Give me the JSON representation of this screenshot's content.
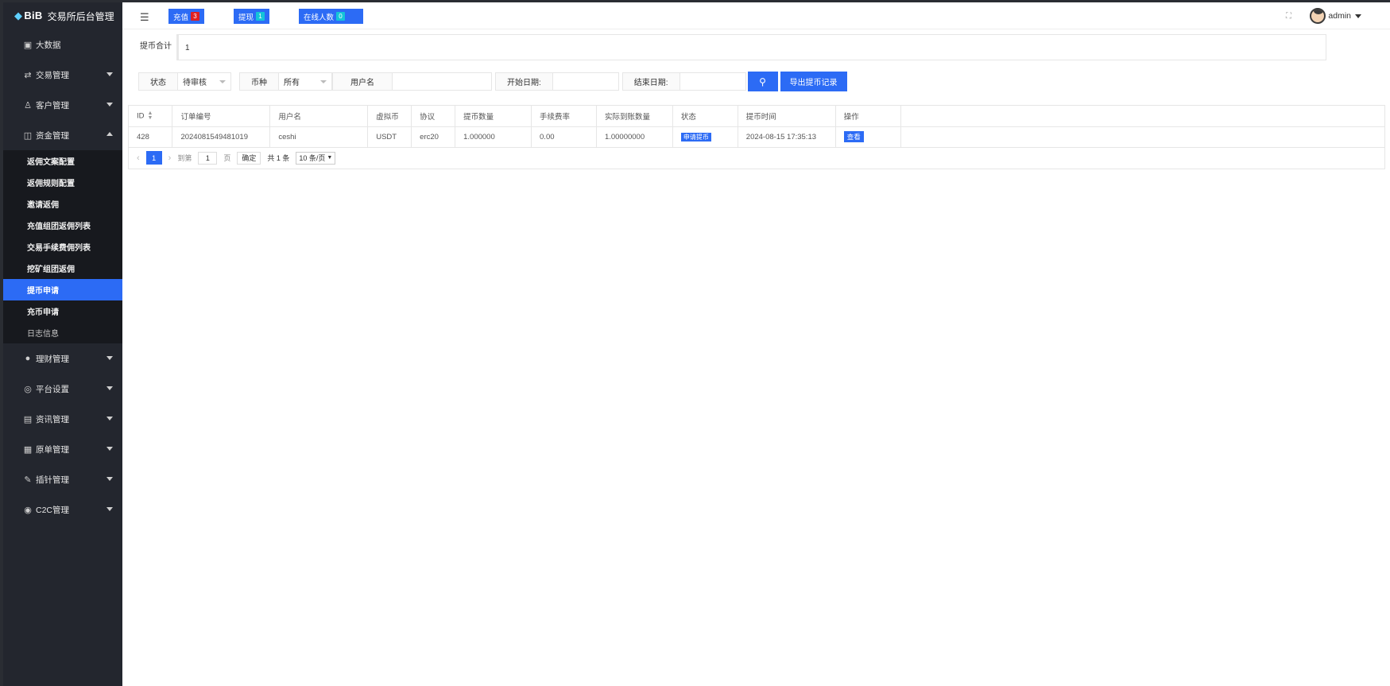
{
  "app": {
    "logo_text": "BiB",
    "title": "交易所后台管理"
  },
  "topbar": {
    "recharge_label": "充值",
    "recharge_count": "3",
    "withdraw_label": "提现",
    "withdraw_count": "1",
    "online_label": "在线人数",
    "online_count": "0",
    "user_name": "admin"
  },
  "sidebar": {
    "items": [
      {
        "label": "大数据",
        "icon": "dashboard-icon"
      },
      {
        "label": "交易管理",
        "icon": "exchange-icon"
      },
      {
        "label": "客户管理",
        "icon": "users-icon"
      },
      {
        "label": "资金管理",
        "icon": "wallet-icon"
      }
    ],
    "sub_items": [
      {
        "label": "返佣文案配置"
      },
      {
        "label": "返佣规则配置"
      },
      {
        "label": "邀请返佣"
      },
      {
        "label": "充值组团返佣列表"
      },
      {
        "label": "交易手续费佣列表"
      },
      {
        "label": "挖矿组团返佣"
      },
      {
        "label": "提币申请"
      },
      {
        "label": "充币申请"
      },
      {
        "label": "日志信息"
      }
    ],
    "items_after": [
      {
        "label": "理财管理",
        "icon": "piggy-bank-icon"
      },
      {
        "label": "平台设置",
        "icon": "settings-icon"
      },
      {
        "label": "资讯管理",
        "icon": "news-icon"
      },
      {
        "label": "原单管理",
        "icon": "document-icon"
      },
      {
        "label": "插针管理",
        "icon": "needle-icon"
      },
      {
        "label": "C2C管理",
        "icon": "c2c-icon"
      }
    ]
  },
  "summary": {
    "label": "提币合计",
    "value": "1"
  },
  "filters": {
    "status_label": "状态",
    "status_value": "待审核",
    "coin_label": "币种",
    "coin_value": "所有",
    "username_label": "用户名",
    "start_date_label": "开始日期:",
    "end_date_label": "结束日期:",
    "export_label": "导出提币记录"
  },
  "table": {
    "headers": [
      "ID",
      "订单编号",
      "用户名",
      "虚拟币",
      "协议",
      "提币数量",
      "手续费率",
      "实际到账数量",
      "状态",
      "提币时间",
      "操作"
    ],
    "rows": [
      {
        "id": "428",
        "order_no": "2024081549481019",
        "username": "ceshi",
        "coin": "USDT",
        "protocol": "erc20",
        "amount": "1.000000",
        "fee_rate": "0.00",
        "actual_amount": "1.00000000",
        "status": "申请提币",
        "time": "2024-08-15 17:35:13",
        "action": "查看"
      }
    ]
  },
  "pager": {
    "current": "1",
    "goto_label": "到第",
    "goto_value": "1",
    "page_unit": "页",
    "confirm_label": "确定",
    "total": "共 1 条",
    "page_size": "10 条/页"
  },
  "colors": {
    "primary": "#2c6bf5",
    "sidebar_bg": "#23262e",
    "badge_red": "#e02020",
    "badge_cyan": "#14c4d8"
  }
}
